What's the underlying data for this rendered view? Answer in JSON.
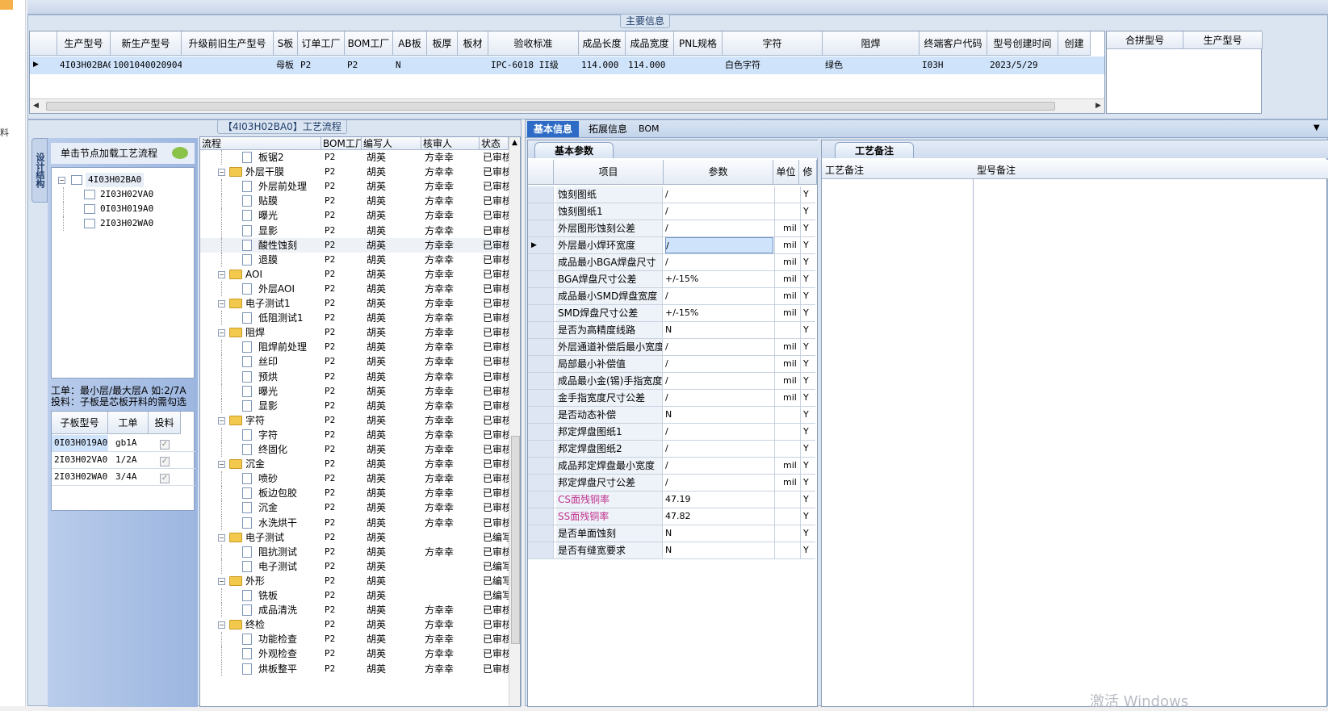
{
  "left_strip": {
    "text": "料"
  },
  "main_info": {
    "title": "主要信息",
    "headers": [
      "生产型号",
      "新生产型号",
      "升级前旧生产型号",
      "S板",
      "订单工厂",
      "BOM工厂",
      "AB板",
      "板厚",
      "板材",
      "验收标准",
      "成品长度",
      "成品宽度",
      "PNL规格",
      "字符",
      "阻焊",
      "终端客户代码",
      "型号创建时间",
      "创建"
    ],
    "row": [
      "4I03H02BA0",
      "10010400209041",
      "",
      "母板",
      "P2",
      "P2",
      "N",
      "",
      "",
      "IPC-6018 II级",
      "114.000",
      "114.000",
      "",
      "白色字符",
      "绿色",
      "I03H",
      "2023/5/29",
      ""
    ],
    "right_headers": [
      "合拼型号",
      "生产型号"
    ]
  },
  "process_flow": {
    "title": "【4I03H02BA0】工艺流程",
    "side_tab": "设计结构",
    "hint": "单击节点加载工艺流程",
    "tree": [
      {
        "label": "4I03H02BA0",
        "root": true
      },
      {
        "label": "2I03H02VA0"
      },
      {
        "label": "0I03H019A0"
      },
      {
        "label": "2I03H02WA0"
      }
    ],
    "note1": "工单：最小层/最大层A 如:2/7A",
    "note2": "投料：子板是芯板开料的需勾选",
    "sub_headers": [
      "子板型号",
      "工单",
      "投料"
    ],
    "sub_rows": [
      {
        "model": "0I03H019A0",
        "order": "gb1A",
        "check": "✓"
      },
      {
        "model": "2I03H02VA0",
        "order": "1/2A",
        "check": "✓"
      },
      {
        "model": "2I03H02WA0",
        "order": "3/4A",
        "check": "✓"
      }
    ],
    "flow_headers": [
      "流程",
      "BOM工厂",
      "编写人",
      "核审人",
      "状态"
    ],
    "flow_rows": [
      {
        "name": "板锯2",
        "level": 2,
        "f": "P2",
        "w": "胡英",
        "r": "方幸幸",
        "s": "已审核"
      },
      {
        "name": "外层干膜",
        "level": 1,
        "f": "P2",
        "w": "胡英",
        "r": "方幸幸",
        "s": "已审核"
      },
      {
        "name": "外层前处理",
        "level": 2,
        "f": "P2",
        "w": "胡英",
        "r": "方幸幸",
        "s": "已审核"
      },
      {
        "name": "贴膜",
        "level": 2,
        "f": "P2",
        "w": "胡英",
        "r": "方幸幸",
        "s": "已审核"
      },
      {
        "name": "曝光",
        "level": 2,
        "f": "P2",
        "w": "胡英",
        "r": "方幸幸",
        "s": "已审核"
      },
      {
        "name": "显影",
        "level": 2,
        "f": "P2",
        "w": "胡英",
        "r": "方幸幸",
        "s": "已审核"
      },
      {
        "name": "酸性蚀刻",
        "level": 2,
        "f": "P2",
        "w": "胡英",
        "r": "方幸幸",
        "s": "已审核"
      },
      {
        "name": "退膜",
        "level": 2,
        "f": "P2",
        "w": "胡英",
        "r": "方幸幸",
        "s": "已审核"
      },
      {
        "name": "AOI",
        "level": 1,
        "f": "P2",
        "w": "胡英",
        "r": "方幸幸",
        "s": "已审核"
      },
      {
        "name": "外层AOI",
        "level": 2,
        "f": "P2",
        "w": "胡英",
        "r": "方幸幸",
        "s": "已审核"
      },
      {
        "name": "电子测试1",
        "level": 1,
        "f": "P2",
        "w": "胡英",
        "r": "方幸幸",
        "s": "已审核"
      },
      {
        "name": "低阻测试1",
        "level": 2,
        "f": "P2",
        "w": "胡英",
        "r": "方幸幸",
        "s": "已审核"
      },
      {
        "name": "阻焊",
        "level": 1,
        "f": "P2",
        "w": "胡英",
        "r": "方幸幸",
        "s": "已审核"
      },
      {
        "name": "阻焊前处理",
        "level": 2,
        "f": "P2",
        "w": "胡英",
        "r": "方幸幸",
        "s": "已审核"
      },
      {
        "name": "丝印",
        "level": 2,
        "f": "P2",
        "w": "胡英",
        "r": "方幸幸",
        "s": "已审核"
      },
      {
        "name": "预烘",
        "level": 2,
        "f": "P2",
        "w": "胡英",
        "r": "方幸幸",
        "s": "已审核"
      },
      {
        "name": "曝光",
        "level": 2,
        "f": "P2",
        "w": "胡英",
        "r": "方幸幸",
        "s": "已审核"
      },
      {
        "name": "显影",
        "level": 2,
        "f": "P2",
        "w": "胡英",
        "r": "方幸幸",
        "s": "已审核"
      },
      {
        "name": "字符",
        "level": 1,
        "f": "P2",
        "w": "胡英",
        "r": "方幸幸",
        "s": "已审核"
      },
      {
        "name": "字符",
        "level": 2,
        "f": "P2",
        "w": "胡英",
        "r": "方幸幸",
        "s": "已审核"
      },
      {
        "name": "终固化",
        "level": 2,
        "f": "P2",
        "w": "胡英",
        "r": "方幸幸",
        "s": "已审核"
      },
      {
        "name": "沉金",
        "level": 1,
        "f": "P2",
        "w": "胡英",
        "r": "方幸幸",
        "s": "已审核"
      },
      {
        "name": "喷砂",
        "level": 2,
        "f": "P2",
        "w": "胡英",
        "r": "方幸幸",
        "s": "已审核"
      },
      {
        "name": "板边包胶",
        "level": 2,
        "f": "P2",
        "w": "胡英",
        "r": "方幸幸",
        "s": "已审核"
      },
      {
        "name": "沉金",
        "level": 2,
        "f": "P2",
        "w": "胡英",
        "r": "方幸幸",
        "s": "已审核"
      },
      {
        "name": "水洗烘干",
        "level": 2,
        "f": "P2",
        "w": "胡英",
        "r": "方幸幸",
        "s": "已审核"
      },
      {
        "name": "电子测试",
        "level": 1,
        "f": "P2",
        "w": "胡英",
        "r": "",
        "s": "已编写"
      },
      {
        "name": "阻抗测试",
        "level": 2,
        "f": "P2",
        "w": "胡英",
        "r": "方幸幸",
        "s": "已审核"
      },
      {
        "name": "电子测试",
        "level": 2,
        "f": "P2",
        "w": "胡英",
        "r": "",
        "s": "已编写"
      },
      {
        "name": "外形",
        "level": 1,
        "f": "P2",
        "w": "胡英",
        "r": "",
        "s": "已编写"
      },
      {
        "name": "铣板",
        "level": 2,
        "f": "P2",
        "w": "胡英",
        "r": "",
        "s": "已编写"
      },
      {
        "name": "成品清洗",
        "level": 2,
        "f": "P2",
        "w": "胡英",
        "r": "方幸幸",
        "s": "已审核"
      },
      {
        "name": "终检",
        "level": 1,
        "f": "P2",
        "w": "胡英",
        "r": "方幸幸",
        "s": "已审核"
      },
      {
        "name": "功能检查",
        "level": 2,
        "f": "P2",
        "w": "胡英",
        "r": "方幸幸",
        "s": "已审核"
      },
      {
        "name": "外观检查",
        "level": 2,
        "f": "P2",
        "w": "胡英",
        "r": "方幸幸",
        "s": "已审核"
      },
      {
        "name": "烘板整平",
        "level": 2,
        "f": "P2",
        "w": "胡英",
        "r": "方幸幸",
        "s": "已审核"
      }
    ]
  },
  "basic": {
    "tabs": [
      "基本信息",
      "拓展信息",
      "BOM"
    ],
    "sub_tab": "基本参数",
    "headers": [
      "项目",
      "参数",
      "单位",
      "修"
    ],
    "rows": [
      {
        "item": "蚀刻图纸",
        "param": "/",
        "unit": "",
        "mod": "Y"
      },
      {
        "item": "蚀刻图纸1",
        "param": "/",
        "unit": "",
        "mod": "Y"
      },
      {
        "item": "外层图形蚀刻公差",
        "param": "/",
        "unit": "mil",
        "mod": "Y"
      },
      {
        "item": "外层最小焊环宽度",
        "param": "/",
        "unit": "mil",
        "mod": "Y",
        "selected": true
      },
      {
        "item": "成品最小BGA焊盘尺寸",
        "param": "/",
        "unit": "mil",
        "mod": "Y"
      },
      {
        "item": "BGA焊盘尺寸公差",
        "param": "+/-15%",
        "unit": "mil",
        "mod": "Y"
      },
      {
        "item": "成品最小SMD焊盘宽度",
        "param": "/",
        "unit": "mil",
        "mod": "Y"
      },
      {
        "item": "SMD焊盘尺寸公差",
        "param": "+/-15%",
        "unit": "mil",
        "mod": "Y"
      },
      {
        "item": "是否为高精度线路",
        "param": "N",
        "unit": "",
        "mod": "Y"
      },
      {
        "item": "外层通道补偿后最小宽度",
        "param": "/",
        "unit": "mil",
        "mod": "Y"
      },
      {
        "item": "局部最小补偿值",
        "param": "/",
        "unit": "mil",
        "mod": "Y"
      },
      {
        "item": "成品最小金(锡)手指宽度",
        "param": "/",
        "unit": "mil",
        "mod": "Y"
      },
      {
        "item": "金手指宽度尺寸公差",
        "param": "/",
        "unit": "mil",
        "mod": "Y"
      },
      {
        "item": "是否动态补偿",
        "param": "N",
        "unit": "",
        "mod": "Y"
      },
      {
        "item": "邦定焊盘图纸1",
        "param": "/",
        "unit": "",
        "mod": "Y"
      },
      {
        "item": "邦定焊盘图纸2",
        "param": "/",
        "unit": "",
        "mod": "Y"
      },
      {
        "item": "成品邦定焊盘最小宽度",
        "param": "/",
        "unit": "mil",
        "mod": "Y"
      },
      {
        "item": "邦定焊盘尺寸公差",
        "param": "/",
        "unit": "mil",
        "mod": "Y"
      },
      {
        "item": "CS面残铜率",
        "param": "47.19",
        "unit": "",
        "mod": "Y",
        "pink": true
      },
      {
        "item": "SS面残铜率",
        "param": "47.82",
        "unit": "",
        "mod": "Y",
        "pink": true
      },
      {
        "item": "是否单面蚀刻",
        "param": "N",
        "unit": "",
        "mod": "Y"
      },
      {
        "item": "是否有缝宽要求",
        "param": "N",
        "unit": "",
        "mod": "Y"
      }
    ]
  },
  "remarks": {
    "tab": "工艺备注",
    "headers": [
      "工艺备注",
      "型号备注"
    ]
  },
  "watermark": "激活 Windows"
}
